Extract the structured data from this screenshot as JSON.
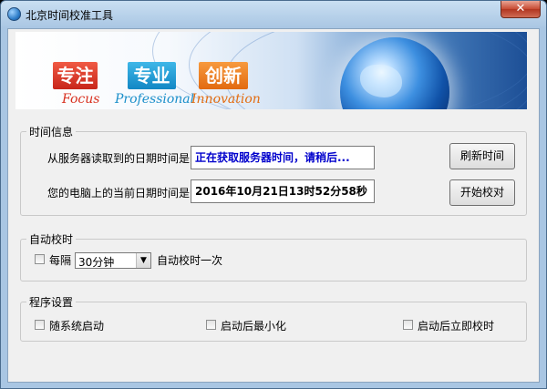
{
  "window": {
    "title": "北京时间校准工具",
    "close_symbol": "✕"
  },
  "banner": {
    "tags": [
      "专注",
      "专业",
      "创新"
    ],
    "taglines": [
      "Focus",
      "Professional",
      "Innovation"
    ]
  },
  "time_info": {
    "title": "时间信息",
    "server_label": "从服务器读取到的日期时间是:",
    "server_value": "正在获取服务器时间，请稍后...",
    "local_label": "您的电脑上的当前日期时间是:",
    "local_value": "2016年10月21日13时52分58秒",
    "refresh_button": "刷新时间",
    "calibrate_button": "开始校对"
  },
  "auto_calibrate": {
    "title": "自动校时",
    "every_label": "每隔",
    "interval_value": "30分钟",
    "suffix_label": "自动校时一次"
  },
  "settings": {
    "title": "程序设置",
    "options": [
      "随系统启动",
      "启动后最小化",
      "启动后立即校时"
    ]
  },
  "colors": {
    "server_value_text": "#0000cc",
    "window_frame": "#a9c6e3"
  }
}
